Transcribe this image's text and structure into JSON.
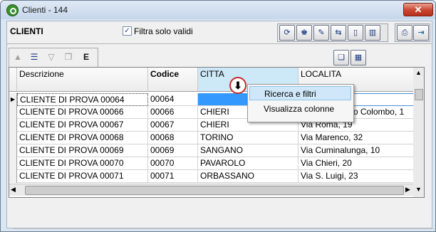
{
  "window": {
    "title": "Clienti - 144",
    "close_label": "✕"
  },
  "header": {
    "label": "CLIENTI",
    "filter_checkbox_label": "Filtra solo validi",
    "filter_checked": true
  },
  "toolbar_right": {
    "icons": [
      "refresh-icon",
      "user-print-icon",
      "wrench-icon",
      "swap-icon",
      "new-document-icon",
      "columns-icon"
    ],
    "group2_icons": [
      "printer-icon",
      "exit-door-icon"
    ]
  },
  "grid_toolbar": {
    "icons": [
      "up-arrow-icon",
      "edit-list-icon",
      "filter-icon",
      "copy-icon",
      "export-excel-icon"
    ],
    "right_icons": [
      "window-icon",
      "grid-icon"
    ]
  },
  "table": {
    "columns": [
      "Descrizione",
      "Codice",
      "CITTA",
      "LOCALITA"
    ],
    "rows": [
      [
        "CLIENTE DI PROVA 00064",
        "00064",
        "",
        ""
      ],
      [
        "CLIENTE DI PROVA 00066",
        "00066",
        "CHIERI",
        "Via Gioacchino Colombo, 1"
      ],
      [
        "CLIENTE DI PROVA 00067",
        "00067",
        "CHIERI",
        "Via Roma, 19"
      ],
      [
        "CLIENTE DI PROVA 00068",
        "00068",
        "TORINO",
        "Via Marenco, 32"
      ],
      [
        "CLIENTE DI PROVA 00069",
        "00069",
        "SANGANO",
        "Via Cuminalunga, 10"
      ],
      [
        "CLIENTE DI PROVA 00070",
        "00070",
        "PAVAROLO",
        "Via Chieri, 20"
      ],
      [
        "CLIENTE DI PROVA 00071",
        "00071",
        "ORBASSANO",
        "Via S. Luigi, 23"
      ]
    ]
  },
  "context_menu": {
    "items": [
      "Ricerca e filtri",
      "Visualizza colonne"
    ],
    "highlighted": 0
  },
  "colors": {
    "accent": "#cfe7f8",
    "marker": "#c62a2a"
  }
}
